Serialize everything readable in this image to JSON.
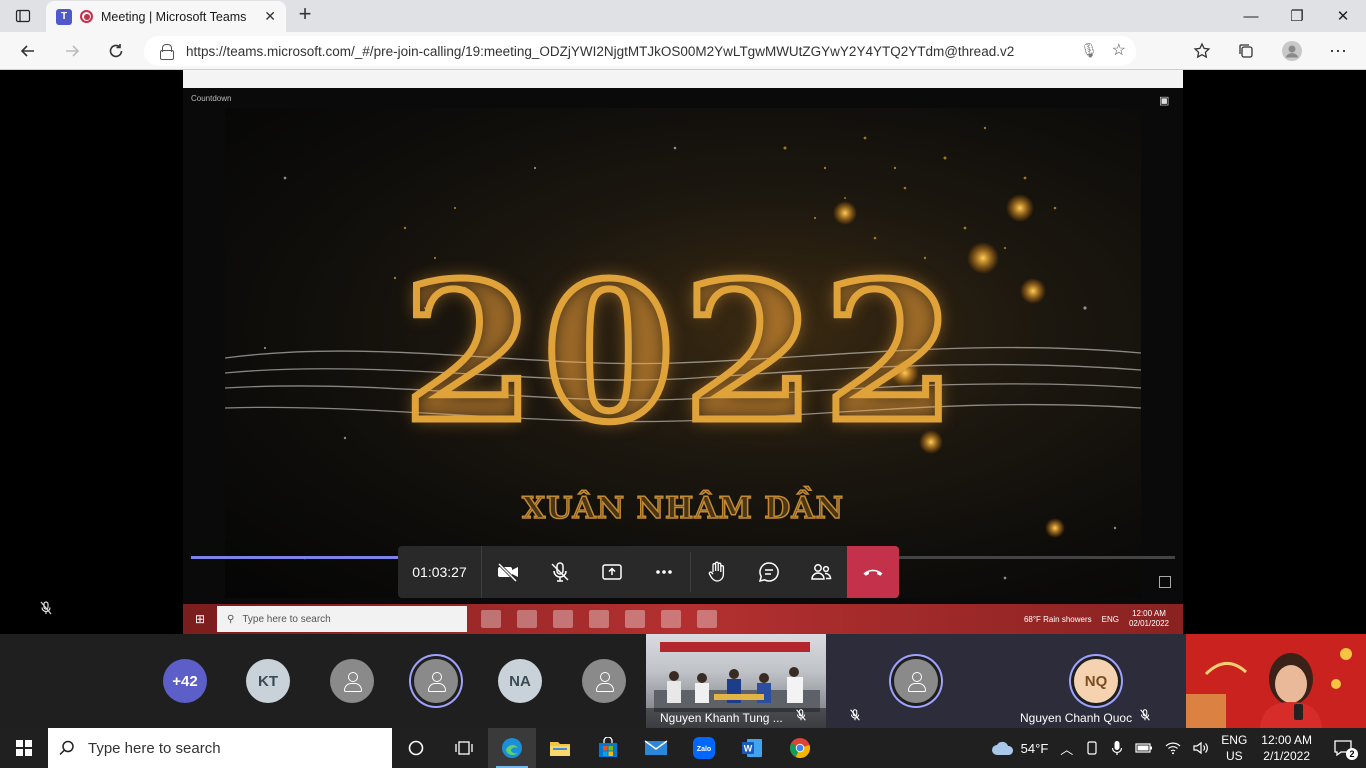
{
  "browser": {
    "tab_title": "Meeting | Microsoft Teams",
    "url": "https://teams.microsoft.com/_#/pre-join-calling/19:meeting_ODZjYWI2NjgtMTJkOS00M2YwLTgwMWUtZGYwY2Y4YTQ2YTdm@thread.v2"
  },
  "shared_screen": {
    "small_title": "Countdown",
    "year_text": "2022",
    "subtitle_text": "XUÂN NHÂM DẦN",
    "inner_search_placeholder": "Type here to search",
    "inner_tray_weather": "68°F  Rain showers",
    "inner_tray_lang": "ENG",
    "inner_tray_time": "12:00 AM",
    "inner_tray_date": "02/01/2022",
    "playback_progress": 0.22
  },
  "call_controls": {
    "timer": "01:03:27"
  },
  "participants": {
    "more_count": "+42",
    "initials": [
      "KT",
      "NA",
      "NQ"
    ],
    "khanh_name": "Nguyen Khanh Tung ...",
    "quoc_name": "Nguyen Chanh Quoc"
  },
  "taskbar": {
    "search_placeholder": "Type here to search",
    "temperature": "54°F",
    "lang_top": "ENG",
    "lang_bottom": "US",
    "time": "12:00 AM",
    "date": "2/1/2022",
    "notification_count": "2"
  },
  "colors": {
    "teams_accent": "#5b5fc7",
    "hangup": "#c4314b",
    "year_gold": "#e0a33a"
  }
}
